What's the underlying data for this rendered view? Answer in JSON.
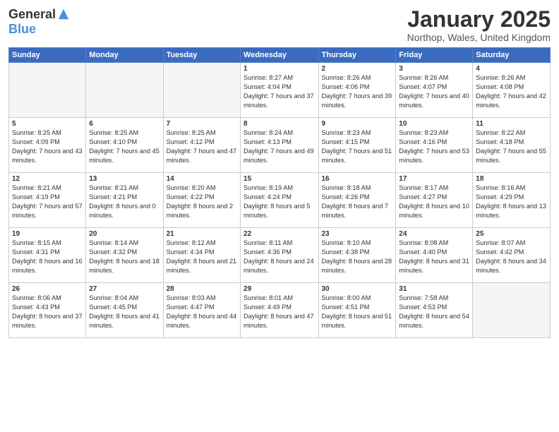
{
  "logo": {
    "general": "General",
    "blue": "Blue"
  },
  "title": "January 2025",
  "subtitle": "Northop, Wales, United Kingdom",
  "days_header": [
    "Sunday",
    "Monday",
    "Tuesday",
    "Wednesday",
    "Thursday",
    "Friday",
    "Saturday"
  ],
  "weeks": [
    [
      {
        "day": "",
        "sunrise": "",
        "sunset": "",
        "daylight": ""
      },
      {
        "day": "",
        "sunrise": "",
        "sunset": "",
        "daylight": ""
      },
      {
        "day": "",
        "sunrise": "",
        "sunset": "",
        "daylight": ""
      },
      {
        "day": "1",
        "sunrise": "Sunrise: 8:27 AM",
        "sunset": "Sunset: 4:04 PM",
        "daylight": "Daylight: 7 hours and 37 minutes."
      },
      {
        "day": "2",
        "sunrise": "Sunrise: 8:26 AM",
        "sunset": "Sunset: 4:06 PM",
        "daylight": "Daylight: 7 hours and 39 minutes."
      },
      {
        "day": "3",
        "sunrise": "Sunrise: 8:26 AM",
        "sunset": "Sunset: 4:07 PM",
        "daylight": "Daylight: 7 hours and 40 minutes."
      },
      {
        "day": "4",
        "sunrise": "Sunrise: 8:26 AM",
        "sunset": "Sunset: 4:08 PM",
        "daylight": "Daylight: 7 hours and 42 minutes."
      }
    ],
    [
      {
        "day": "5",
        "sunrise": "Sunrise: 8:25 AM",
        "sunset": "Sunset: 4:09 PM",
        "daylight": "Daylight: 7 hours and 43 minutes."
      },
      {
        "day": "6",
        "sunrise": "Sunrise: 8:25 AM",
        "sunset": "Sunset: 4:10 PM",
        "daylight": "Daylight: 7 hours and 45 minutes."
      },
      {
        "day": "7",
        "sunrise": "Sunrise: 8:25 AM",
        "sunset": "Sunset: 4:12 PM",
        "daylight": "Daylight: 7 hours and 47 minutes."
      },
      {
        "day": "8",
        "sunrise": "Sunrise: 8:24 AM",
        "sunset": "Sunset: 4:13 PM",
        "daylight": "Daylight: 7 hours and 49 minutes."
      },
      {
        "day": "9",
        "sunrise": "Sunrise: 8:23 AM",
        "sunset": "Sunset: 4:15 PM",
        "daylight": "Daylight: 7 hours and 51 minutes."
      },
      {
        "day": "10",
        "sunrise": "Sunrise: 8:23 AM",
        "sunset": "Sunset: 4:16 PM",
        "daylight": "Daylight: 7 hours and 53 minutes."
      },
      {
        "day": "11",
        "sunrise": "Sunrise: 8:22 AM",
        "sunset": "Sunset: 4:18 PM",
        "daylight": "Daylight: 7 hours and 55 minutes."
      }
    ],
    [
      {
        "day": "12",
        "sunrise": "Sunrise: 8:21 AM",
        "sunset": "Sunset: 4:19 PM",
        "daylight": "Daylight: 7 hours and 57 minutes."
      },
      {
        "day": "13",
        "sunrise": "Sunrise: 8:21 AM",
        "sunset": "Sunset: 4:21 PM",
        "daylight": "Daylight: 8 hours and 0 minutes."
      },
      {
        "day": "14",
        "sunrise": "Sunrise: 8:20 AM",
        "sunset": "Sunset: 4:22 PM",
        "daylight": "Daylight: 8 hours and 2 minutes."
      },
      {
        "day": "15",
        "sunrise": "Sunrise: 8:19 AM",
        "sunset": "Sunset: 4:24 PM",
        "daylight": "Daylight: 8 hours and 5 minutes."
      },
      {
        "day": "16",
        "sunrise": "Sunrise: 8:18 AM",
        "sunset": "Sunset: 4:26 PM",
        "daylight": "Daylight: 8 hours and 7 minutes."
      },
      {
        "day": "17",
        "sunrise": "Sunrise: 8:17 AM",
        "sunset": "Sunset: 4:27 PM",
        "daylight": "Daylight: 8 hours and 10 minutes."
      },
      {
        "day": "18",
        "sunrise": "Sunrise: 8:16 AM",
        "sunset": "Sunset: 4:29 PM",
        "daylight": "Daylight: 8 hours and 13 minutes."
      }
    ],
    [
      {
        "day": "19",
        "sunrise": "Sunrise: 8:15 AM",
        "sunset": "Sunset: 4:31 PM",
        "daylight": "Daylight: 8 hours and 16 minutes."
      },
      {
        "day": "20",
        "sunrise": "Sunrise: 8:14 AM",
        "sunset": "Sunset: 4:32 PM",
        "daylight": "Daylight: 8 hours and 18 minutes."
      },
      {
        "day": "21",
        "sunrise": "Sunrise: 8:12 AM",
        "sunset": "Sunset: 4:34 PM",
        "daylight": "Daylight: 8 hours and 21 minutes."
      },
      {
        "day": "22",
        "sunrise": "Sunrise: 8:11 AM",
        "sunset": "Sunset: 4:36 PM",
        "daylight": "Daylight: 8 hours and 24 minutes."
      },
      {
        "day": "23",
        "sunrise": "Sunrise: 8:10 AM",
        "sunset": "Sunset: 4:38 PM",
        "daylight": "Daylight: 8 hours and 28 minutes."
      },
      {
        "day": "24",
        "sunrise": "Sunrise: 8:08 AM",
        "sunset": "Sunset: 4:40 PM",
        "daylight": "Daylight: 8 hours and 31 minutes."
      },
      {
        "day": "25",
        "sunrise": "Sunrise: 8:07 AM",
        "sunset": "Sunset: 4:42 PM",
        "daylight": "Daylight: 8 hours and 34 minutes."
      }
    ],
    [
      {
        "day": "26",
        "sunrise": "Sunrise: 8:06 AM",
        "sunset": "Sunset: 4:43 PM",
        "daylight": "Daylight: 8 hours and 37 minutes."
      },
      {
        "day": "27",
        "sunrise": "Sunrise: 8:04 AM",
        "sunset": "Sunset: 4:45 PM",
        "daylight": "Daylight: 8 hours and 41 minutes."
      },
      {
        "day": "28",
        "sunrise": "Sunrise: 8:03 AM",
        "sunset": "Sunset: 4:47 PM",
        "daylight": "Daylight: 8 hours and 44 minutes."
      },
      {
        "day": "29",
        "sunrise": "Sunrise: 8:01 AM",
        "sunset": "Sunset: 4:49 PM",
        "daylight": "Daylight: 8 hours and 47 minutes."
      },
      {
        "day": "30",
        "sunrise": "Sunrise: 8:00 AM",
        "sunset": "Sunset: 4:51 PM",
        "daylight": "Daylight: 8 hours and 51 minutes."
      },
      {
        "day": "31",
        "sunrise": "Sunrise: 7:58 AM",
        "sunset": "Sunset: 4:53 PM",
        "daylight": "Daylight: 8 hours and 54 minutes."
      },
      {
        "day": "",
        "sunrise": "",
        "sunset": "",
        "daylight": ""
      }
    ]
  ]
}
